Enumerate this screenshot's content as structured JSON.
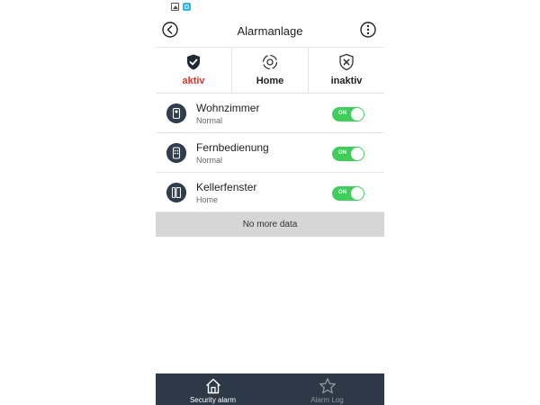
{
  "header": {
    "title": "Alarmanlage"
  },
  "modes": [
    {
      "label": "aktiv",
      "icon": "shield-check-icon",
      "active": true
    },
    {
      "label": "Home",
      "icon": "home-mode-icon",
      "active": false
    },
    {
      "label": "inaktiv",
      "icon": "shield-x-icon",
      "active": false
    }
  ],
  "devices": [
    {
      "name": "Wohnzimmer",
      "status": "Normal",
      "toggle": "ON",
      "icon": "pir-sensor-icon"
    },
    {
      "name": "Fernbedienung",
      "status": "Normal",
      "toggle": "ON",
      "icon": "remote-control-icon"
    },
    {
      "name": "Kellerfenster",
      "status": "Home",
      "toggle": "ON",
      "icon": "door-sensor-icon"
    }
  ],
  "list_footer": "No more data",
  "tabs": [
    {
      "label": "Security alarm",
      "icon": "home-icon",
      "active": true
    },
    {
      "label": "Alarm Log",
      "icon": "star-icon",
      "active": false
    }
  ],
  "colors": {
    "active_mode": "#e0322e",
    "toggle_on": "#3ecf5a",
    "tabbar_bg": "#2d3946",
    "device_icon_bg": "#2f3d4c"
  }
}
